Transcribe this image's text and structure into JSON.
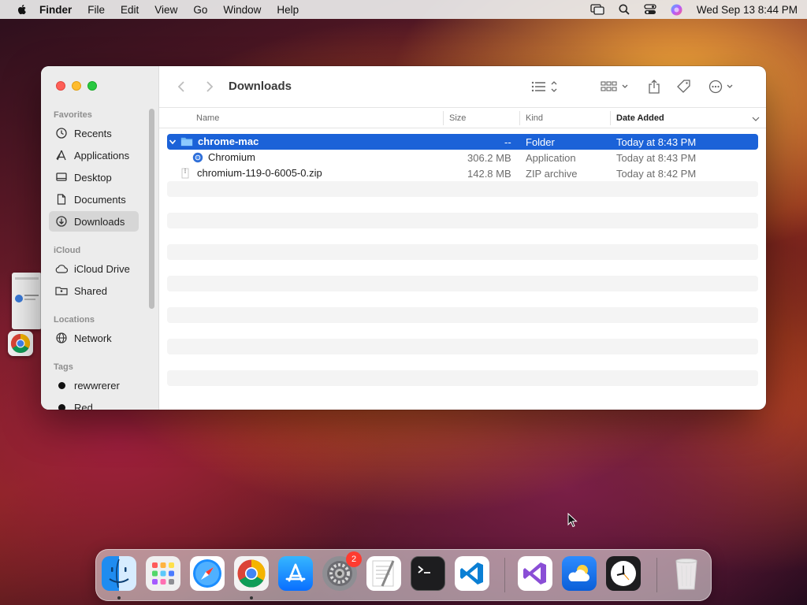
{
  "menubar": {
    "app_name": "Finder",
    "menus": [
      "File",
      "Edit",
      "View",
      "Go",
      "Window",
      "Help"
    ],
    "clock": "Wed Sep 13  8:44 PM"
  },
  "window": {
    "title": "Downloads",
    "sidebar": {
      "favorites_label": "Favorites",
      "favorites": [
        {
          "label": "Recents",
          "icon": "clock-icon"
        },
        {
          "label": "Applications",
          "icon": "applications-icon"
        },
        {
          "label": "Desktop",
          "icon": "desktop-icon"
        },
        {
          "label": "Documents",
          "icon": "document-icon"
        },
        {
          "label": "Downloads",
          "icon": "download-icon",
          "selected": true
        }
      ],
      "icloud_label": "iCloud",
      "icloud": [
        {
          "label": "iCloud Drive",
          "icon": "cloud-icon"
        },
        {
          "label": "Shared",
          "icon": "shared-folder-icon"
        }
      ],
      "locations_label": "Locations",
      "locations": [
        {
          "label": "Network",
          "icon": "globe-icon"
        }
      ],
      "tags_label": "Tags",
      "tags": [
        {
          "label": "rewwrerer",
          "color": "#111111"
        },
        {
          "label": "Red",
          "color": "#111111"
        }
      ]
    },
    "columns": {
      "name": "Name",
      "size": "Size",
      "kind": "Kind",
      "date_added": "Date Added"
    },
    "files": [
      {
        "name": "chrome-mac",
        "size": "--",
        "kind": "Folder",
        "date_added": "Today at 8:43 PM",
        "selected": true,
        "expanded": true,
        "icon": "folder-icon"
      },
      {
        "name": "Chromium",
        "size": "306.2 MB",
        "kind": "Application",
        "date_added": "Today at 8:43 PM",
        "indent": true,
        "icon": "chromium-icon"
      },
      {
        "name": "chromium-119-0-6005-0.zip",
        "size": "142.8 MB",
        "kind": "ZIP archive",
        "date_added": "Today at 8:42 PM",
        "icon": "zip-file-icon"
      }
    ]
  },
  "dock": {
    "apps": [
      "finder",
      "launchpad",
      "safari",
      "chrome",
      "app-store",
      "system-settings",
      "textedit",
      "terminal",
      "vscode",
      "visual-studio",
      "weather",
      "clock",
      "trash"
    ],
    "settings_badge": "2"
  },
  "colors": {
    "selection": "#1b62d8",
    "accent": "#1b62d8",
    "badge": "#ff3b30"
  }
}
